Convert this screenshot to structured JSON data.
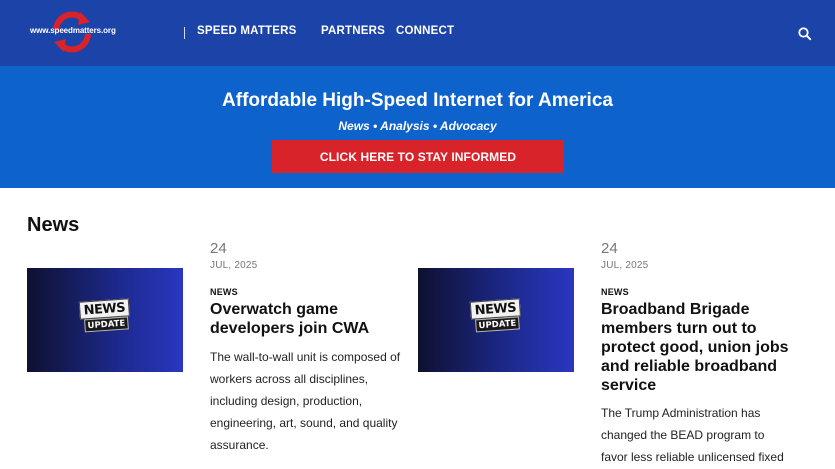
{
  "header": {
    "logo_url_text": "www.speedmatters.org",
    "nav": [
      "SPEED MATTERS",
      "PARTNERS",
      "CONNECT"
    ],
    "search_icon": "search-icon"
  },
  "hero": {
    "title": "Affordable High-Speed Internet for America",
    "subtitle": "News • Analysis • Advocacy",
    "cta_label": "CLICK HERE TO STAY INFORMED"
  },
  "news": {
    "heading": "News",
    "articles": [
      {
        "day": "24",
        "month_year": "JUL, 2025",
        "category": "NEWS",
        "title": "Overwatch game developers join CWA",
        "excerpt": "The wall-to-wall unit is composed of workers across all disciplines, including design, production, engineering, art, sound, and quality assurance.",
        "thumb_top": "NEWS",
        "thumb_bottom": "UPDATE"
      },
      {
        "day": "24",
        "month_year": "JUL, 2025",
        "category": "NEWS",
        "title": "Broadband Brigade members turn out to protect good, union jobs and reliable broadband service",
        "excerpt": "The Trump Administration has changed the BEAD program to favor less reliable unlicensed fixed",
        "thumb_top": "NEWS",
        "thumb_bottom": "UPDATE"
      }
    ]
  },
  "colors": {
    "nav_bg": "#1c43a8",
    "hero_bg": "#0d63cb",
    "cta_bg": "#d9232a"
  }
}
